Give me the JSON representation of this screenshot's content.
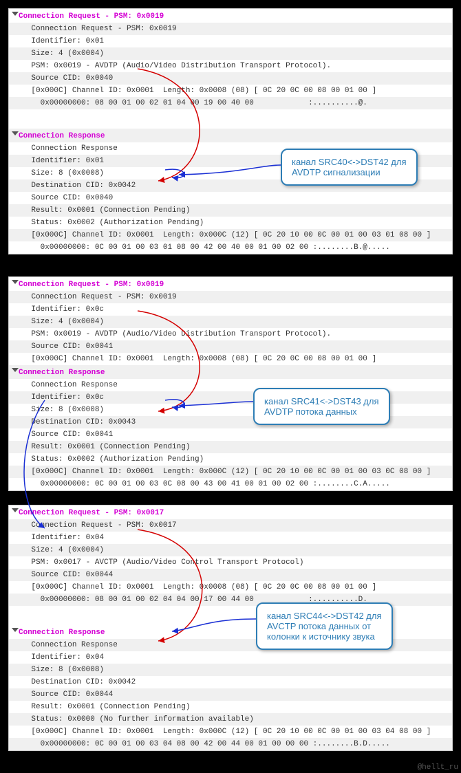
{
  "panels": [
    {
      "header": "Connection Request - PSM: 0x0019",
      "rows": [
        "Connection Request - PSM: 0x0019",
        "Identifier: 0x01",
        "Size: 4 (0x0004)",
        "PSM: 0x0019 - AVDTP (Audio/Video Distribution Transport Protocol).",
        "Source CID: 0x0040",
        "[0x000C] Channel ID: 0x0001  Length: 0x0008 (08) [ 0C 20 0C 00 08 00 01 00 ]",
        "  0x00000000: 08 00 01 00 02 01 04 00 19 00 40 00            :..........@."
      ],
      "rows2_header": "Connection Response",
      "rows2": [
        "Connection Response",
        "Identifier: 0x01",
        "Size: 8 (0x0008)",
        "Destination CID: 0x0042",
        "Source CID: 0x0040",
        "Result: 0x0001 (Connection Pending)",
        "Status: 0x0002 (Authorization Pending)",
        "[0x000C] Channel ID: 0x0001  Length: 0x000C (12) [ 0C 20 10 00 0C 00 01 00 03 01 08 00 ]",
        "  0x00000000: 0C 00 01 00 03 01 08 00 42 00 40 00 01 00 02 00 :........B.@....."
      ]
    },
    {
      "header": "Connection Request - PSM: 0x0019",
      "rows": [
        "Connection Request - PSM: 0x0019",
        "Identifier: 0x0c",
        "Size: 4 (0x0004)",
        "PSM: 0x0019 - AVDTP (Audio/Video Distribution Transport Protocol).",
        "Source CID: 0x0041",
        "[0x000C] Channel ID: 0x0001  Length: 0x0008 (08) [ 0C 20 0C 00 08 00 01 00 ]"
      ],
      "rows2_header": "Connection Response",
      "rows2": [
        "Connection Response",
        "Identifier: 0x0c",
        "Size: 8 (0x0008)",
        "Destination CID: 0x0043",
        "Source CID: 0x0041",
        "Result: 0x0001 (Connection Pending)",
        "Status: 0x0002 (Authorization Pending)",
        "[0x000C] Channel ID: 0x0001  Length: 0x000C (12) [ 0C 20 10 00 0C 00 01 00 03 0C 08 00 ]",
        "  0x00000000: 0C 00 01 00 03 0C 08 00 43 00 41 00 01 00 02 00 :........C.A....."
      ]
    },
    {
      "header": "Connection Request - PSM: 0x0017",
      "rows": [
        "Connection Request - PSM: 0x0017",
        "Identifier: 0x04",
        "Size: 4 (0x0004)",
        "PSM: 0x0017 - AVCTP (Audio/Video Control Transport Protocol)",
        "Source CID: 0x0044",
        "[0x000C] Channel ID: 0x0001  Length: 0x0008 (08) [ 0C 20 0C 00 08 00 01 00 ]",
        "  0x00000000: 08 00 01 00 02 04 04 00 17 00 44 00            :..........D."
      ],
      "rows2_header": "Connection Response",
      "rows2": [
        "Connection Response",
        "Identifier: 0x04",
        "Size: 8 (0x0008)",
        "Destination CID: 0x0042",
        "Source CID: 0x0044",
        "Result: 0x0001 (Connection Pending)",
        "Status: 0x0000 (No further information available)",
        "[0x000C] Channel ID: 0x0001  Length: 0x000C (12) [ 0C 20 10 00 0C 00 01 00 03 04 08 00 ]",
        "  0x00000000: 0C 00 01 00 03 04 08 00 42 00 44 00 01 00 00 00 :........B.D....."
      ]
    }
  ],
  "callouts": [
    {
      "text1": "канал SRC40<->DST42 для",
      "text2": "AVDTP сигнализации"
    },
    {
      "text1": "канал SRC41<->DST43 для",
      "text2": "AVDTP потока данных"
    },
    {
      "text1": "канал SRC44<->DST42 для",
      "text2": "AVCTP потока данных от",
      "text3": "колонки к источнику звука"
    }
  ],
  "watermark": "@hellt_ru"
}
